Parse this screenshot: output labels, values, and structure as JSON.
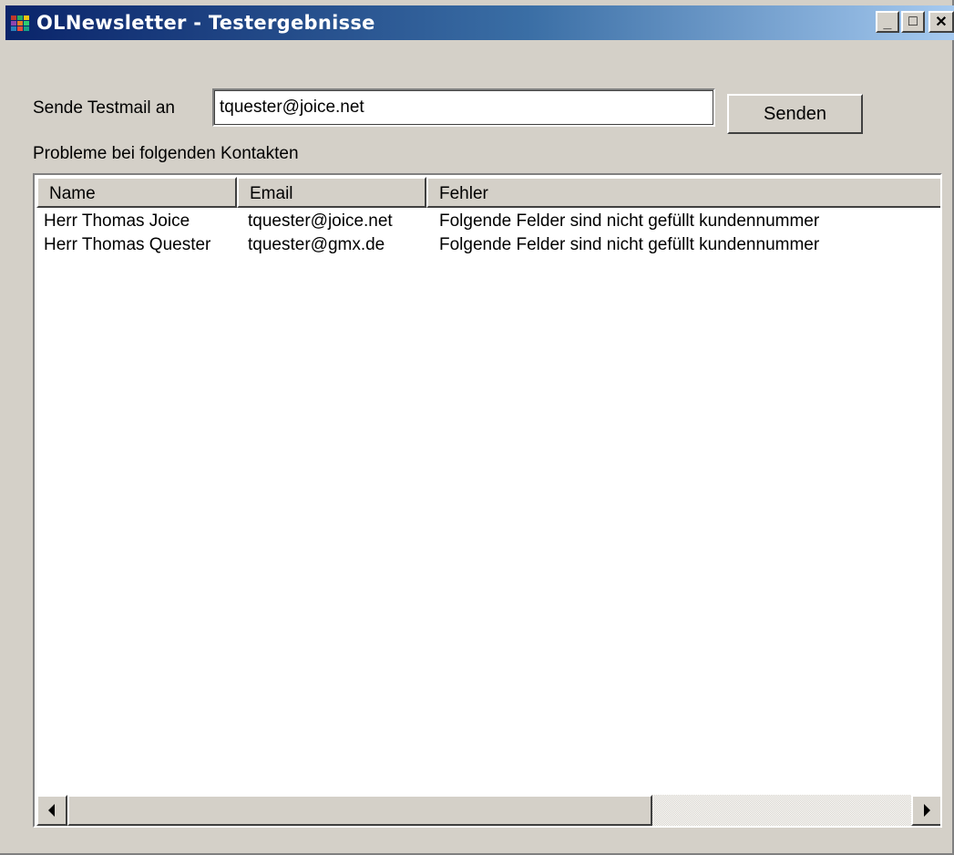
{
  "window": {
    "title": "OLNewsletter - Testergebnisse",
    "icon": "app-grid-icon",
    "controls": {
      "minimize": "_",
      "maximize": "□",
      "close": "✕"
    }
  },
  "form": {
    "send_label": "Sende Testmail an",
    "email_value": "tquester@joice.net",
    "send_button": "Senden",
    "problems_label": "Probleme bei folgenden Kontakten"
  },
  "table": {
    "columns": [
      "Name",
      "Email",
      "Fehler"
    ],
    "rows": [
      {
        "name": "Herr Thomas Joice",
        "email": "tquester@joice.net",
        "error": "Folgende Felder sind nicht gefüllt kundennummer"
      },
      {
        "name": "Herr Thomas Quester",
        "email": "tquester@gmx.de",
        "error": "Folgende Felder sind nicht gefüllt kundennummer"
      }
    ]
  },
  "colors": {
    "titlebar_start": "#0a246a",
    "titlebar_end": "#a6caf0",
    "face": "#d4d0c8"
  }
}
